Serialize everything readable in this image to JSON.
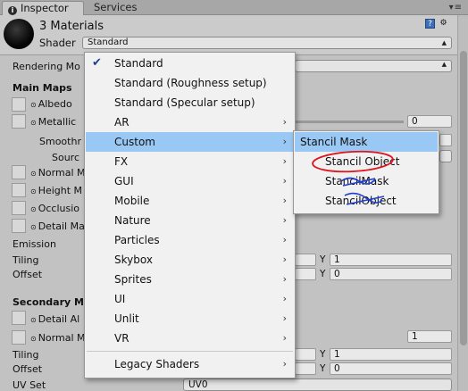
{
  "tabs": [
    {
      "label": "Inspector",
      "active": true
    },
    {
      "label": "Services",
      "active": false
    }
  ],
  "header": {
    "title": "3 Materials",
    "shader_label": "Shader",
    "shader_value": "Standard"
  },
  "inspector": {
    "rendering_mode_label": "Rendering Mo",
    "main_maps_label": "Main Maps",
    "albedo_label": "Albedo",
    "metallic_label": "Metallic",
    "metallic_value": "0",
    "smoothness_label": "Smoothr",
    "source_label": "Sourc",
    "normal_map_label": "Normal M",
    "height_map_label": "Height M",
    "occlusion_label": "Occlusio",
    "detail_mask_label": "Detail Ma",
    "emission_label": "Emission",
    "tiling_label": "Tiling",
    "tiling_y_label": "Y",
    "tiling_y_value": "1",
    "offset_label": "Offset",
    "offset_y_label": "Y",
    "offset_y_value": "0",
    "secondary_maps_label": "Secondary M",
    "detail_albedo_label": "Detail Al",
    "secondary_normal_label": "Normal M",
    "secondary_normal_value": "1",
    "sec_tiling_label": "Tiling",
    "sec_tiling_y_label": "Y",
    "sec_tiling_y_value": "1",
    "sec_offset_label": "Offset",
    "sec_offset_y_label": "Y",
    "sec_offset_y_value": "0",
    "uv_set_label": "UV Set",
    "uv_set_value": "UV0"
  },
  "shader_menu": {
    "items": [
      {
        "label": "Standard",
        "checked": true,
        "submenu": false
      },
      {
        "label": "Standard (Roughness setup)",
        "submenu": false
      },
      {
        "label": "Standard (Specular setup)",
        "submenu": false
      },
      {
        "label": "AR",
        "submenu": true
      },
      {
        "label": "Custom",
        "submenu": true,
        "highlighted": true
      },
      {
        "label": "FX",
        "submenu": true
      },
      {
        "label": "GUI",
        "submenu": true
      },
      {
        "label": "Mobile",
        "submenu": true
      },
      {
        "label": "Nature",
        "submenu": true
      },
      {
        "label": "Particles",
        "submenu": true
      },
      {
        "label": "Skybox",
        "submenu": true
      },
      {
        "label": "Sprites",
        "submenu": true
      },
      {
        "label": "UI",
        "submenu": true
      },
      {
        "label": "Unlit",
        "submenu": true
      },
      {
        "label": "VR",
        "submenu": true
      },
      {
        "label": "Legacy Shaders",
        "submenu": true
      }
    ]
  },
  "custom_submenu": {
    "items": [
      {
        "label": "Stancil Mask",
        "highlighted": true
      },
      {
        "label": "Stancil Object",
        "annotation": "red-circle"
      },
      {
        "label": "StancilMask",
        "annotation": "blue-scribble"
      },
      {
        "label": "StancilObject",
        "annotation": "blue-scribble"
      }
    ]
  },
  "colors": {
    "highlight": "#99c8f4",
    "annotation_red": "#e0141e",
    "annotation_blue": "#1f3fd0"
  },
  "icons": {
    "inspector_tab": "info-icon",
    "help": "book-icon",
    "settings": "gear-icon",
    "check": "check-icon",
    "submenu": "chevron-right-icon"
  }
}
